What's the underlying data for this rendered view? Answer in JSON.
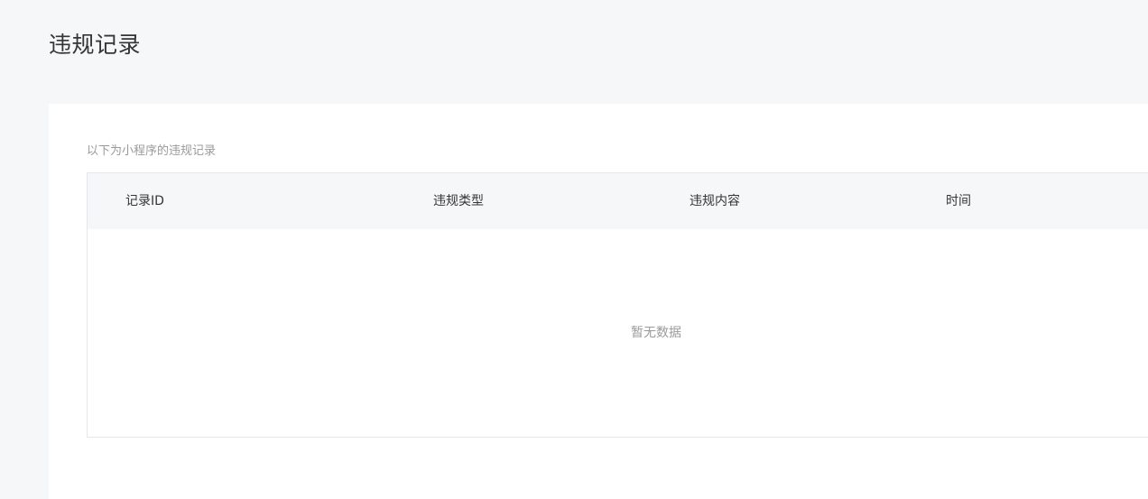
{
  "page": {
    "title": "违规记录"
  },
  "panel": {
    "description": "以下为小程序的违规记录"
  },
  "table": {
    "columns": [
      "记录ID",
      "违规类型",
      "违规内容",
      "时间"
    ],
    "rows": [],
    "empty_text": "暂无数据"
  }
}
